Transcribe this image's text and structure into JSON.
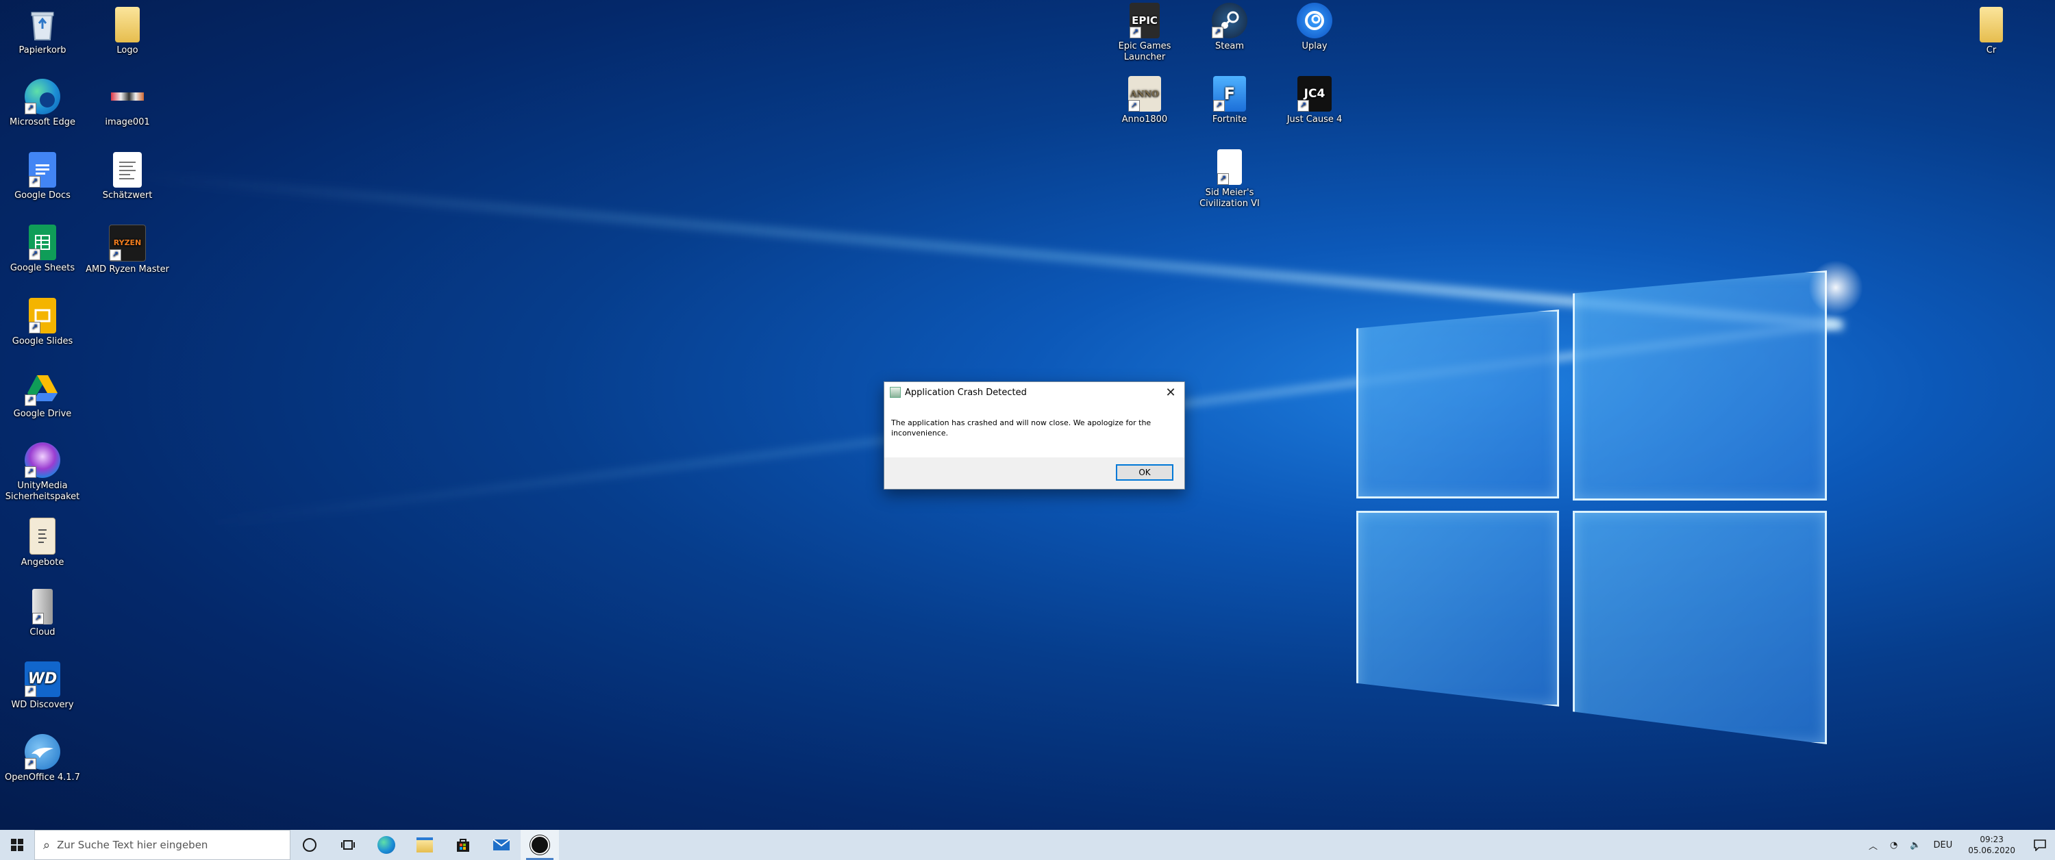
{
  "desktop": {
    "icons_left": [
      {
        "label": "Papierkorb",
        "icon": "recycle-bin-icon"
      },
      {
        "label": "Logo",
        "icon": "folder-icon"
      },
      {
        "label": "Microsoft Edge",
        "icon": "edge-icon"
      },
      {
        "label": "image001",
        "icon": "image-file-icon"
      },
      {
        "label": "Google Docs",
        "icon": "google-docs-icon"
      },
      {
        "label": "Schätzwert",
        "icon": "document-icon"
      },
      {
        "label": "Google Sheets",
        "icon": "google-sheets-icon"
      },
      {
        "label": "AMD Ryzen Master",
        "icon": "ryzen-master-icon"
      },
      {
        "label": "Google Slides",
        "icon": "google-slides-icon"
      },
      {
        "label": "Google Drive",
        "icon": "google-drive-icon"
      },
      {
        "label": "UnityMedia Sicherheitspaket",
        "icon": "unitymedia-icon"
      },
      {
        "label": "Angebote",
        "icon": "offers-file-icon"
      },
      {
        "label": "Cloud",
        "icon": "cloud-drive-icon"
      },
      {
        "label": "WD Discovery",
        "icon": "wd-discovery-icon"
      },
      {
        "label": "OpenOffice 4.1.7",
        "icon": "openoffice-icon"
      }
    ],
    "icons_games": [
      {
        "label": "Epic Games Launcher",
        "icon": "epic-games-icon",
        "glyph": "EPIC"
      },
      {
        "label": "Steam",
        "icon": "steam-icon"
      },
      {
        "label": "Uplay",
        "icon": "uplay-icon"
      },
      {
        "label": "Anno1800",
        "icon": "anno-icon",
        "glyph": "ANNO"
      },
      {
        "label": "Fortnite",
        "icon": "fortnite-icon",
        "glyph": "F"
      },
      {
        "label": "Just Cause 4",
        "icon": "just-cause-icon",
        "glyph": "JC4"
      },
      {
        "label": "Sid Meier's Civilization VI",
        "icon": "civilization-icon"
      }
    ],
    "icon_right": {
      "label": "Cr",
      "icon": "folder-icon"
    },
    "ryzen_glyph": "RYZEN",
    "wd_glyph": "WD"
  },
  "dialog": {
    "title": "Application Crash Detected",
    "message": "The application has crashed and will now close. We apologize for the inconvenience.",
    "ok_label": "OK",
    "close_glyph": "✕"
  },
  "taskbar": {
    "search_placeholder": "Zur Suche Text hier eingeben",
    "pinned": [
      "cortana-icon",
      "task-view-icon",
      "edge-icon",
      "file-explorer-icon",
      "store-icon",
      "mail-icon",
      "unreal-engine-icon"
    ],
    "tray": {
      "language": "DEU",
      "time": "09:23",
      "date": "05.06.2020"
    }
  }
}
